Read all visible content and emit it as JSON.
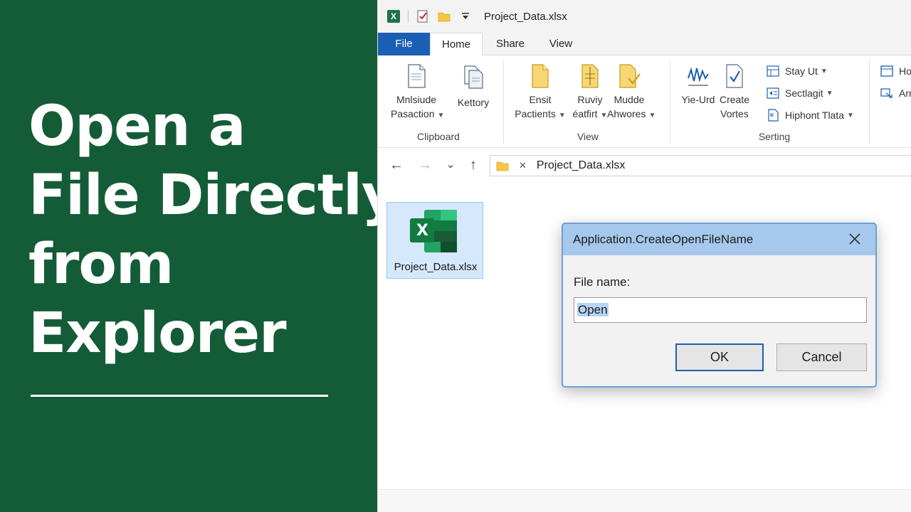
{
  "headline": {
    "lines": [
      "Open a",
      "File Directly",
      "from",
      "Explorer"
    ]
  },
  "window": {
    "title": "Project_Data.xlsx",
    "tabs": {
      "file": "File",
      "home": "Home",
      "share": "Share",
      "view": "View"
    },
    "ribbon": {
      "clipboard": {
        "label": "Clipboard",
        "btn1": {
          "line1": "Mnlsiude",
          "line2": "Pasaction"
        },
        "btn2": {
          "line1": "Kettory"
        }
      },
      "view": {
        "label": "View",
        "btn1": {
          "line1": "Ensit",
          "line2": "Pactients"
        },
        "btn2": {
          "line1": "Ruviy",
          "line2": "éatfirt"
        },
        "btn3": {
          "line1": "Mudde",
          "line2": "Ahwores"
        }
      },
      "serting": {
        "label": "Serting",
        "btn1": {
          "line1": "Yie-Urd"
        },
        "btn2": {
          "line1": "Create",
          "line2": "Vortes"
        },
        "rows": [
          "Stay Ut",
          "Sectlagit",
          "Hiphont Tlata"
        ]
      },
      "extra": {
        "rows": [
          "Ho",
          "Arr"
        ]
      }
    },
    "address": {
      "path": "Project_Data.xlsx"
    },
    "file": {
      "name": "Project_Data.xlsx",
      "badge": "X"
    }
  },
  "dialog": {
    "title": "Application.CreateOpenFileName",
    "label": "File name:",
    "value": "Open",
    "ok": "OK",
    "cancel": "Cancel"
  },
  "colors": {
    "panel_green": "#145c37",
    "file_tab_blue": "#1a5fb4",
    "dialog_title": "#a6c8ec",
    "excel_green": "#1e7145"
  }
}
